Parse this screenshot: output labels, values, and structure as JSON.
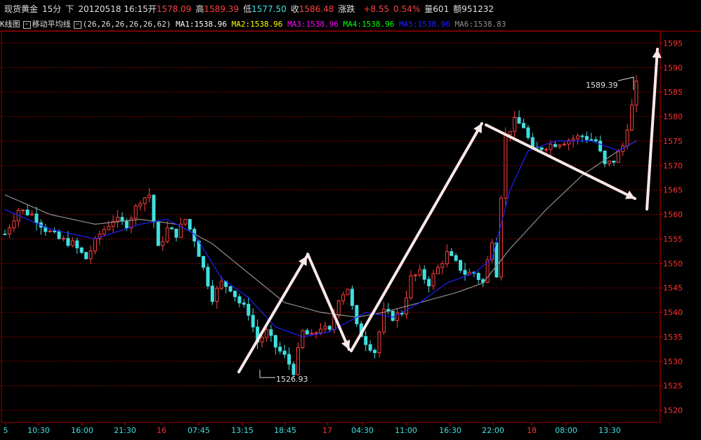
{
  "header": {
    "name": "现货黄金",
    "period": "15分",
    "arrow": "下",
    "datetime": "20120518 16:15",
    "open_label": "开",
    "open": "1578.09",
    "high_label": "高",
    "high": "1589.39",
    "low_label": "低",
    "low": "1577.50",
    "close_label": "收",
    "close": "1586.48",
    "change_label": "涨跌",
    "change": "+8.55",
    "change_pct": "0.54%",
    "volume_label": "量",
    "volume": "601",
    "amount_label": "额",
    "amount": "951232"
  },
  "indicator_bar": {
    "kline_label": "K线图",
    "ma_label": "移动平均线",
    "params": "(26,26,26,26,26,62)",
    "ma1": "MA1:1538.96",
    "ma2": "MA2:1538.96",
    "ma3": "MA3:1538.96",
    "ma4": "MA4:1538.96",
    "ma5": "MA5:1538.96",
    "ma6": "MA6:1538.83"
  },
  "colors": {
    "background": "#000000",
    "up": "#ff4040",
    "down": "#40e0e0",
    "grid": "#8b0000",
    "axis_label": "#ff3030",
    "time_label": "#40e0e0",
    "ma_blue": "#2020ff",
    "ma_gray": "#909090",
    "ma1": "#ffffff",
    "ma2": "#ffff00",
    "ma3": "#ff00ff",
    "ma4": "#00ff00",
    "ma5": "#0000ff",
    "ma6": "#909090",
    "arrow": "#ffe8e8"
  },
  "chart_data": {
    "type": "candlestick",
    "y_ticks": [
      "1595",
      "1590",
      "1585",
      "1580",
      "1575",
      "1570",
      "1565",
      "1560",
      "1555",
      "1550",
      "1545",
      "1540",
      "1535",
      "1530",
      "1525",
      "1520"
    ],
    "ylim": [
      1517.5,
      1597.5
    ],
    "x_ticks": [
      "5",
      "10:30",
      "16:00",
      "21:30",
      "16",
      "07:45",
      "13:15",
      "18:45",
      "17",
      "04:30",
      "11:00",
      "16:30",
      "22:00",
      "18",
      "08:00",
      "13:30"
    ],
    "x_tick_is_day": [
      false,
      false,
      false,
      false,
      true,
      false,
      false,
      false,
      true,
      false,
      false,
      false,
      false,
      true,
      false,
      false
    ],
    "annotations": [
      {
        "text": "1526.93",
        "value": 1526.93,
        "kind": "low"
      },
      {
        "text": "1589.39",
        "value": 1589.39,
        "kind": "high"
      }
    ],
    "price_path": [
      [
        0,
        1556
      ],
      [
        3,
        1561
      ],
      [
        6,
        1560
      ],
      [
        9,
        1557
      ],
      [
        12,
        1555
      ],
      [
        15,
        1554
      ],
      [
        18,
        1551
      ],
      [
        21,
        1556
      ],
      [
        24,
        1559
      ],
      [
        27,
        1558
      ],
      [
        30,
        1563
      ],
      [
        32,
        1564
      ],
      [
        34,
        1553
      ],
      [
        36,
        1557
      ],
      [
        38,
        1556
      ],
      [
        40,
        1559
      ],
      [
        42,
        1555
      ],
      [
        44,
        1549
      ],
      [
        46,
        1543
      ],
      [
        48,
        1546
      ],
      [
        50,
        1545
      ],
      [
        52,
        1542
      ],
      [
        54,
        1540
      ],
      [
        56,
        1534
      ],
      [
        58,
        1536
      ],
      [
        60,
        1533
      ],
      [
        62,
        1531
      ],
      [
        64,
        1528
      ],
      [
        66,
        1536
      ],
      [
        68,
        1535
      ],
      [
        70,
        1537
      ],
      [
        72,
        1536
      ],
      [
        74,
        1543
      ],
      [
        76,
        1545
      ],
      [
        78,
        1537
      ],
      [
        80,
        1534
      ],
      [
        82,
        1532
      ],
      [
        84,
        1540
      ],
      [
        86,
        1539
      ],
      [
        88,
        1540
      ],
      [
        90,
        1547
      ],
      [
        92,
        1548
      ],
      [
        94,
        1546
      ],
      [
        96,
        1549
      ],
      [
        98,
        1552
      ],
      [
        100,
        1550
      ],
      [
        102,
        1548
      ],
      [
        104,
        1548
      ],
      [
        106,
        1546
      ],
      [
        108,
        1555
      ],
      [
        109,
        1548
      ],
      [
        110,
        1564
      ],
      [
        111,
        1576
      ],
      [
        113,
        1579
      ],
      [
        115,
        1578
      ],
      [
        117,
        1573
      ],
      [
        120,
        1574
      ],
      [
        124,
        1575
      ],
      [
        128,
        1576
      ],
      [
        131,
        1575
      ],
      [
        133,
        1570
      ],
      [
        135,
        1571
      ],
      [
        137,
        1574
      ],
      [
        138,
        1578
      ],
      [
        139,
        1582
      ],
      [
        140,
        1586.48
      ]
    ],
    "ma_fast": [
      [
        0,
        1561
      ],
      [
        10,
        1557
      ],
      [
        20,
        1555
      ],
      [
        30,
        1558
      ],
      [
        36,
        1559
      ],
      [
        42,
        1556
      ],
      [
        48,
        1547
      ],
      [
        54,
        1543
      ],
      [
        60,
        1537
      ],
      [
        66,
        1535
      ],
      [
        72,
        1536
      ],
      [
        80,
        1540
      ],
      [
        86,
        1539
      ],
      [
        92,
        1542
      ],
      [
        98,
        1546
      ],
      [
        104,
        1548
      ],
      [
        108,
        1551
      ],
      [
        112,
        1565
      ],
      [
        116,
        1573
      ],
      [
        122,
        1575
      ],
      [
        130,
        1575
      ],
      [
        136,
        1573
      ],
      [
        140,
        1575
      ]
    ],
    "ma_slow": [
      [
        0,
        1564
      ],
      [
        10,
        1560
      ],
      [
        20,
        1558
      ],
      [
        30,
        1559
      ],
      [
        38,
        1558
      ],
      [
        46,
        1554
      ],
      [
        54,
        1548
      ],
      [
        62,
        1542
      ],
      [
        70,
        1540
      ],
      [
        78,
        1539
      ],
      [
        84,
        1540
      ],
      [
        92,
        1542
      ],
      [
        100,
        1544
      ],
      [
        106,
        1546
      ],
      [
        112,
        1553
      ],
      [
        120,
        1561
      ],
      [
        128,
        1568
      ],
      [
        136,
        1573
      ],
      [
        140,
        1575
      ]
    ]
  }
}
